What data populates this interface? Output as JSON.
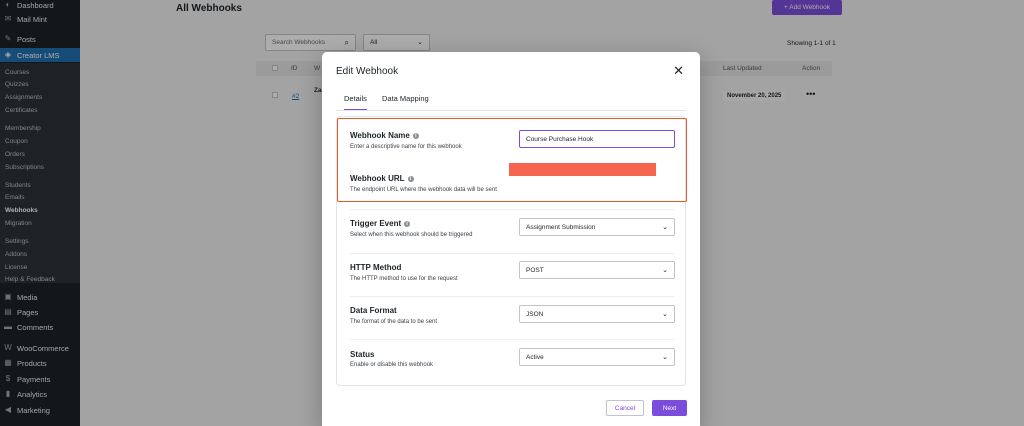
{
  "sidebar": {
    "top_items": [
      {
        "label": "Dashboard",
        "icon": "dashboard-icon"
      },
      {
        "label": "Mail Mint",
        "icon": "mail-icon"
      },
      {
        "label": "Posts",
        "icon": "pin-icon"
      },
      {
        "label": "Creator LMS",
        "icon": "lms-icon"
      }
    ],
    "lms_submenu": [
      "Courses",
      "Quizzes",
      "Assignments",
      "Certificates",
      "Membership",
      "Coupon",
      "Orders",
      "Subscriptions",
      "Students",
      "Emails",
      "Webhooks",
      "Migration",
      "Settings",
      "Addons",
      "License",
      "Help & Feedback"
    ],
    "current_submenu": "Webhooks",
    "bottom_items": [
      {
        "label": "Media",
        "icon": "media-icon"
      },
      {
        "label": "Pages",
        "icon": "pages-icon"
      },
      {
        "label": "Comments",
        "icon": "comments-icon"
      },
      {
        "label": "WooCommerce",
        "icon": "woocommerce-icon"
      },
      {
        "label": "Products",
        "icon": "products-icon"
      },
      {
        "label": "Payments",
        "icon": "payments-icon"
      },
      {
        "label": "Analytics",
        "icon": "analytics-icon"
      },
      {
        "label": "Marketing",
        "icon": "marketing-icon"
      }
    ]
  },
  "page": {
    "title": "All Webhooks",
    "add_button": "+ Add Webhook",
    "search_placeholder": "Search Webhooks",
    "filter_value": "All",
    "showing": "Showing 1-1 of 1",
    "columns": {
      "id": "ID",
      "name": "W",
      "last_updated": "Last Updated",
      "action": "Action"
    },
    "row": {
      "id": "#2",
      "name": "Za",
      "date": "November 20, 2025",
      "actions": "•••"
    }
  },
  "modal": {
    "title": "Edit Webhook",
    "tabs": [
      "Details",
      "Data Mapping"
    ],
    "fields": [
      {
        "label": "Webhook Name",
        "description": "Enter a descriptive name for this webhook",
        "value": "Course Purchase Hook",
        "type": "text"
      },
      {
        "label": "Webhook URL",
        "description": "The endpoint URL where the webhook data will be sent",
        "value": "",
        "type": "text"
      },
      {
        "label": "Trigger Event",
        "description": "Select when this webhook should be triggered",
        "value": "Assignment Submission",
        "type": "select"
      },
      {
        "label": "HTTP Method",
        "description": "The HTTP method to use for the request",
        "value": "POST",
        "type": "select"
      },
      {
        "label": "Data Format",
        "description": "The format of the data to be sent",
        "value": "JSON",
        "type": "select"
      },
      {
        "label": "Status",
        "description": "Enable or disable this webhook",
        "value": "Active",
        "type": "select"
      }
    ],
    "cancel": "Cancel",
    "next": "Next"
  },
  "colors": {
    "accent": "#7c4ddb",
    "sidebar": "#1d2327",
    "active_menu": "#2271b1",
    "highlight": "#e4572e",
    "redaction": "#f3654f"
  }
}
